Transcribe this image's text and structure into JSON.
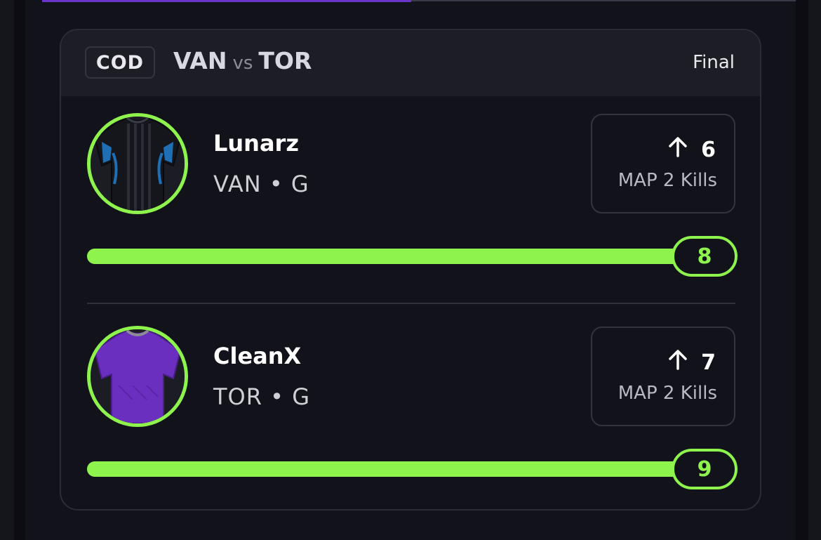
{
  "header": {
    "sport": "COD",
    "home": "VAN",
    "vs": "vs",
    "away": "TOR",
    "status": "Final"
  },
  "players": [
    {
      "name": "Lunarz",
      "team": "VAN",
      "separator": "•",
      "position": "G",
      "direction": "up",
      "line": "6",
      "stat_label": "MAP 2 Kills",
      "actual": "8",
      "progress": 1.0,
      "jersey": "black-blue",
      "jersey_colors": [
        "#14161c",
        "#1f6fb5"
      ]
    },
    {
      "name": "CleanX",
      "team": "TOR",
      "separator": "•",
      "position": "G",
      "direction": "up",
      "line": "7",
      "stat_label": "MAP 2 Kills",
      "actual": "9",
      "progress": 1.0,
      "jersey": "purple",
      "jersey_colors": [
        "#6b2fc0",
        "#4a1f8a"
      ]
    }
  ],
  "colors": {
    "accent_green": "#8ef34d",
    "brand_purple": "#6a33c9",
    "card_bg": "#12121a",
    "header_bg": "#1d1d26"
  }
}
